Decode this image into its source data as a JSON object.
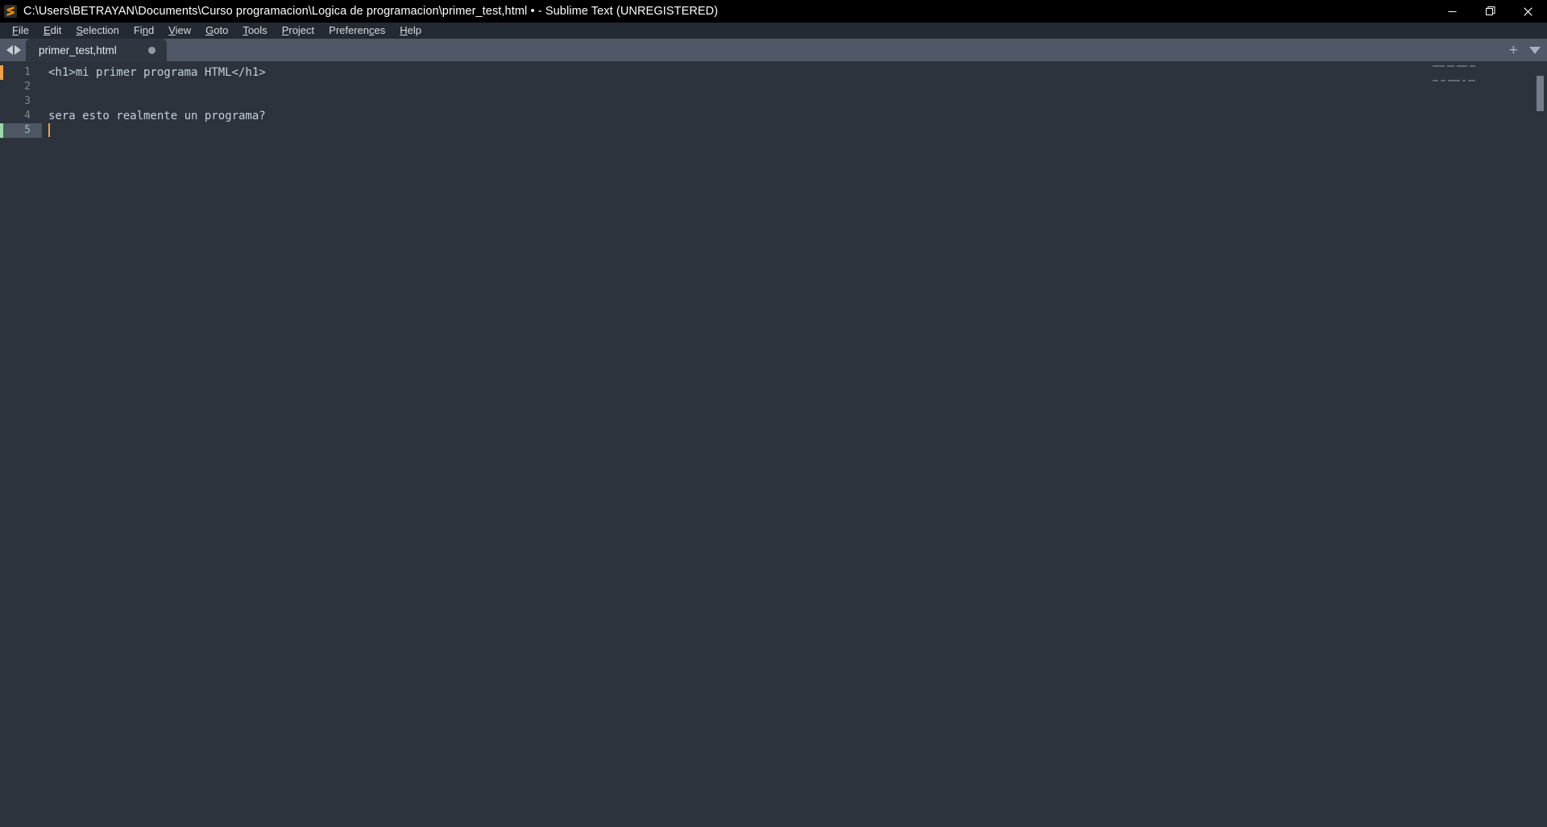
{
  "window": {
    "title": "C:\\Users\\BETRAYAN\\Documents\\Curso programacion\\Logica de programacion\\primer_test,html • - Sublime Text (UNREGISTERED)",
    "logo_icon": "sublime-text-logo",
    "controls": {
      "minimize": {
        "icon": "minimize-icon",
        "glyph": "—"
      },
      "maximize": {
        "icon": "restore-icon",
        "glyph": "❐"
      },
      "close": {
        "icon": "close-icon",
        "glyph": "✕"
      }
    }
  },
  "menubar": {
    "items": [
      {
        "label": "File",
        "mnemonic": "F"
      },
      {
        "label": "Edit",
        "mnemonic": "E"
      },
      {
        "label": "Selection",
        "mnemonic": "S"
      },
      {
        "label": "Find",
        "mnemonic": "n"
      },
      {
        "label": "View",
        "mnemonic": "V"
      },
      {
        "label": "Goto",
        "mnemonic": "G"
      },
      {
        "label": "Tools",
        "mnemonic": "T"
      },
      {
        "label": "Project",
        "mnemonic": "P"
      },
      {
        "label": "Preferences",
        "mnemonic": "c"
      },
      {
        "label": "Help",
        "mnemonic": "H"
      }
    ]
  },
  "tabbar": {
    "prev_tab_icon": "arrow-left-icon",
    "next_tab_icon": "arrow-right-icon",
    "new_tab_label": "+",
    "tab_menu_icon": "chevron-down-icon",
    "tabs": [
      {
        "label": "primer_test,html",
        "modified": true,
        "active": true
      }
    ]
  },
  "editor": {
    "lines": [
      {
        "number": "1",
        "text": "<h1>mi primer programa HTML</h1>",
        "marker": "#f0a04b"
      },
      {
        "number": "2",
        "text": "",
        "marker": ""
      },
      {
        "number": "3",
        "text": "",
        "marker": ""
      },
      {
        "number": "4",
        "text": "sera esto realmente un programa?",
        "marker": ""
      },
      {
        "number": "5",
        "text": "",
        "marker": "#9ed8a8"
      }
    ],
    "active_line": 5,
    "cursor_line": 5,
    "cursor_column": 1,
    "caret_color": "#f0a04b"
  },
  "minimap": {
    "rows": [
      [
        60,
        36,
        52,
        28
      ],
      [],
      [],
      [
        28,
        24,
        58,
        18,
        34
      ],
      []
    ],
    "scrollbar_visible": true
  },
  "colors": {
    "titlebar_bg": "#000000",
    "menubar_bg": "#242a32",
    "tabbar_bg": "#4e5866",
    "active_tab_bg": "#2f3640",
    "editor_bg": "#2c333d",
    "text_fg": "#c5d0dd",
    "gutter_fg": "#7a8693",
    "active_line_bg": "#4d5764",
    "accent": "#f0a04b"
  }
}
